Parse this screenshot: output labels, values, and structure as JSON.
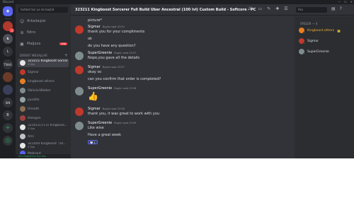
{
  "window": {
    "title": "Discord",
    "controls": [
      "—",
      "☐",
      "✕"
    ]
  },
  "servers": [
    {
      "label": "",
      "name": "discord-home"
    },
    {
      "label": "",
      "name": "server-red",
      "badge": "3"
    },
    {
      "label": "",
      "name": "server-chess"
    },
    {
      "label": "L",
      "name": "server-l"
    },
    {
      "label": "TWoS",
      "name": "server-twos"
    },
    {
      "label": "",
      "name": "server-avatar-1"
    },
    {
      "label": "",
      "name": "server-avatar-2"
    },
    {
      "label": "SIN",
      "name": "server-sin"
    },
    {
      "label": "B",
      "name": "server-b"
    },
    {
      "label": "+",
      "name": "add-server"
    },
    {
      "label": "◎",
      "name": "explore-servers"
    }
  ],
  "dm_panel": {
    "search_placeholder": "Sohbet bul ya da başlat",
    "nav": [
      {
        "label": "Arkadaşlar",
        "icon": "friends-icon"
      },
      {
        "label": "Nitro",
        "icon": "nitro-icon"
      },
      {
        "label": "Mağaza",
        "icon": "shop-icon",
        "badge": "YENİ"
      }
    ],
    "header": "DİREKT MESAJLAR",
    "items": [
      {
        "name": "323211 Kingboost Sorcer...",
        "sub": "4 Üye",
        "color": "#e6e6e6"
      },
      {
        "name": "Sigmar",
        "color": "#c0392b"
      },
      {
        "name": "kingboost.others",
        "color": "#e67e22"
      },
      {
        "name": "ObliviorWalker",
        "color": "#7f8c8d"
      },
      {
        "name": "pyrolits",
        "color": "#95a5a6"
      },
      {
        "name": "Hirseth",
        "color": "#8e6e53"
      },
      {
        "name": "Helegon",
        "color": "#a04040"
      },
      {
        "name": "323411(1+2) Kingboos...",
        "sub": "3 Üye",
        "color": "#e6e6e6"
      },
      {
        "name": "Ami",
        "color": "#bdc3c7"
      },
      {
        "name": "321044 Kingboost \"20...",
        "sub": "3 Üye",
        "color": "#e6e6e6"
      },
      {
        "name": "Mebrant",
        "color": "#5865f2"
      }
    ],
    "userbar": "Ses Bağlantısı Kuruldu"
  },
  "channel": {
    "title": "323211 Kingboost Sorcerer Full Build Uber Ancestral (100 lvl) Custom Build - Softcore - PC",
    "search_placeholder": "Ara"
  },
  "messages": [
    {
      "type": "continuation",
      "lines": [
        "picture*"
      ]
    },
    {
      "author": "Sigmar",
      "time": "Bugün saat 23:54",
      "avatar": "#c0392b",
      "lines": [
        "thank you for your compliments",
        "ok",
        "do you have any question?"
      ]
    },
    {
      "author": "SuperGreenie",
      "time": "Bugün saat 23:57",
      "avatar": "#7f8c8d",
      "lines": [
        "Nope,you gave all the details"
      ]
    },
    {
      "author": "Sigmar",
      "time": "Bugün saat 23:57",
      "avatar": "#c0392b",
      "lines": [
        "okay so",
        "can you confirm that order is completed?"
      ]
    },
    {
      "author": "SuperGreenie",
      "time": "Bugün saat 23:58",
      "avatar": "#7f8c8d",
      "lines": [],
      "emoji": "👍"
    },
    {
      "author": "Sigmar",
      "time": "Bugün saat 23:58",
      "avatar": "#c0392b",
      "lines": [
        "thank you, it was great to work with you"
      ]
    },
    {
      "author": "SuperGreenie",
      "time": "Bugün saat 23:59",
      "avatar": "#7f8c8d",
      "lines": [
        "Like wise",
        "Have a great week"
      ],
      "reaction": "🤍 1"
    }
  ],
  "members": {
    "header": "ÜYELER — 4",
    "list": [
      {
        "name": "Kingboost.others",
        "crown": "👑",
        "avatar": "#e67e22",
        "orange": true
      },
      {
        "name": "Sigmar",
        "avatar": "#c0392b"
      },
      {
        "name": "SuperGreenie",
        "avatar": "#7f8c8d"
      }
    ]
  },
  "colors": {
    "accent": "#5865f2",
    "online": "#23a559",
    "danger": "#f23f43"
  }
}
